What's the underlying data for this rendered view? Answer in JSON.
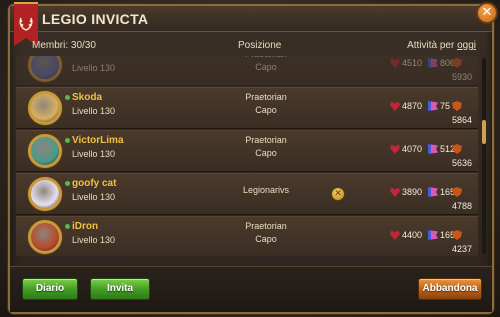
{
  "window": {
    "title": "LEGIO INVICTA"
  },
  "header": {
    "members": "Membri: 30/30",
    "position": "Posizione",
    "activity_prefix": "Attività per ",
    "activity_link": "oggi"
  },
  "members": [
    {
      "name": "",
      "level": "Livello 130",
      "role": "Praetorian",
      "rank": "Capo",
      "hearts": "4510",
      "flags": "806",
      "shields": "5930",
      "avatar_color": "#5a6ab8",
      "partial": true
    },
    {
      "name": "Skoda",
      "level": "Livello 130",
      "role": "Praetorian",
      "rank": "Capo",
      "hearts": "4870",
      "flags": "75",
      "shields": "5864",
      "avatar_color": "#d8b060"
    },
    {
      "name": "VictorLima",
      "level": "Livello 130",
      "role": "Praetorian",
      "rank": "Capo",
      "hearts": "4070",
      "flags": "512",
      "shields": "5636",
      "avatar_color": "#4a9a8a"
    },
    {
      "name": "goofy cat",
      "level": "Livello 130",
      "role": "Legionarivs",
      "rank": "",
      "hearts": "3890",
      "flags": "165",
      "shields": "4788",
      "avatar_color": "#e8e0f0",
      "has_action": true
    },
    {
      "name": "iDron",
      "level": "Livello 130",
      "role": "Praetorian",
      "rank": "Capo",
      "hearts": "4400",
      "flags": "165",
      "shields": "4237",
      "avatar_color": "#b84a2a"
    }
  ],
  "footer": {
    "diary": "Diario",
    "invite": "Invita",
    "leave": "Abbandona"
  },
  "colors": {
    "gold_name": "#f0c040",
    "green_button": "#3f9a22",
    "orange_button": "#b86018",
    "banner_red": "#b22222"
  }
}
